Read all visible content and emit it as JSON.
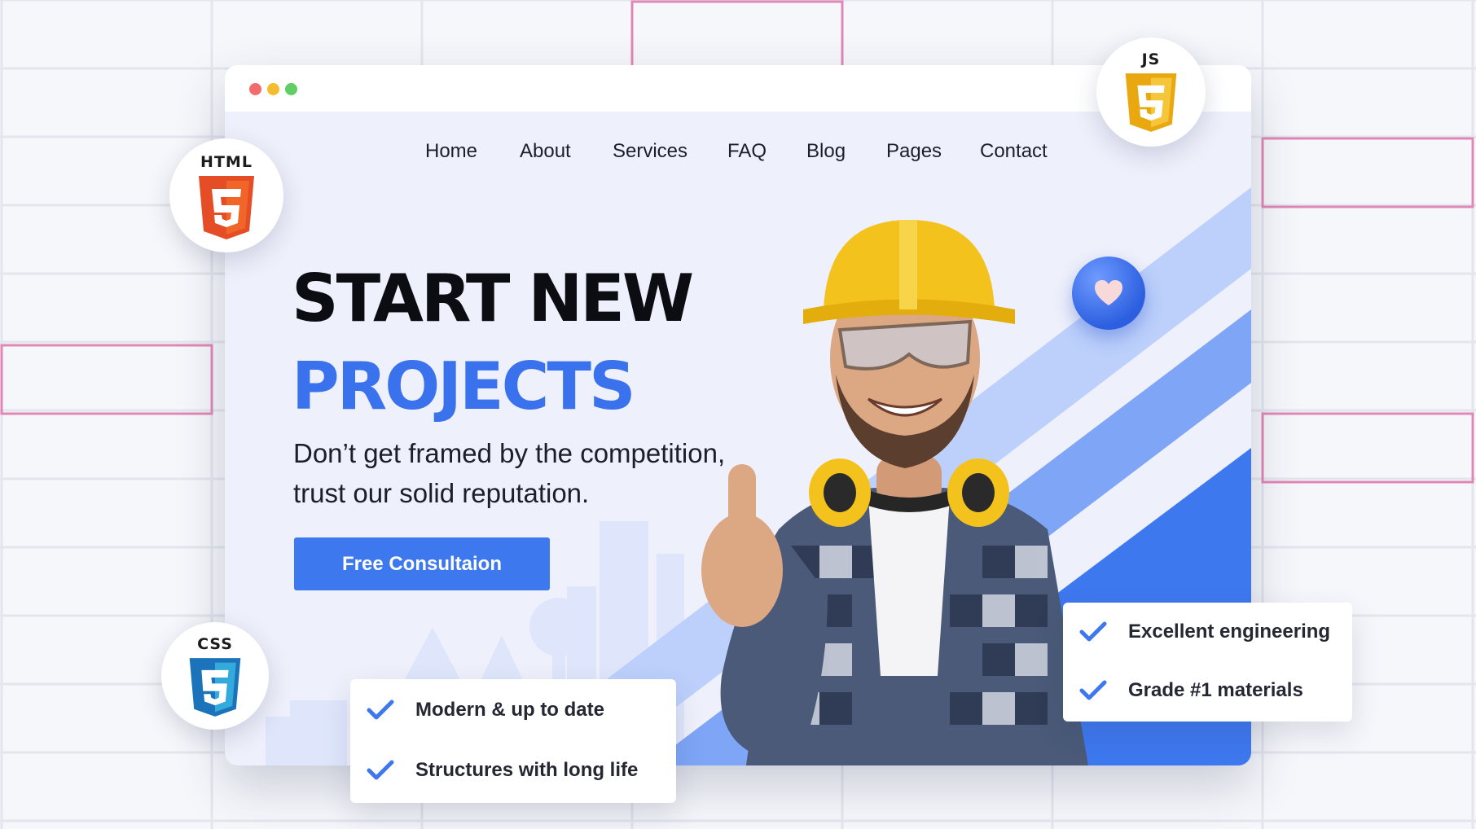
{
  "icons": {
    "window_controls": [
      "close-dot",
      "minimize-dot",
      "maximize-dot"
    ],
    "check": "check-icon",
    "heart": "heart-icon",
    "html_logo": "html5-shield-icon",
    "css_logo": "css3-shield-icon",
    "js_logo": "js-shield-icon"
  },
  "nav": {
    "items": [
      {
        "label": "Home"
      },
      {
        "label": "About"
      },
      {
        "label": "Services"
      },
      {
        "label": "FAQ"
      },
      {
        "label": "Blog"
      },
      {
        "label": "Pages"
      },
      {
        "label": "Contact"
      }
    ]
  },
  "hero": {
    "headline_line1": "START NEW",
    "headline_line2": "PROJECTS",
    "subtitle_line1": "Don’t get framed by the competition,",
    "subtitle_line2": "trust our solid reputation.",
    "cta_label": "Free Consultaion"
  },
  "badges": {
    "html": "HTML",
    "css": "CSS",
    "js": "JS"
  },
  "cards": {
    "left": [
      {
        "label": "Modern & up to date"
      },
      {
        "label": "Structures with long life"
      }
    ],
    "right": [
      {
        "label": "Excellent engineering"
      },
      {
        "label": "Grade #1 materials"
      }
    ]
  },
  "colors": {
    "accent_blue": "#3e78ee",
    "light_blue": "#b9cdfb",
    "headline_dark": "#0c0d12",
    "html_orange": "#e44d26",
    "css_blue": "#1b73ba",
    "js_yellow": "#f0b429",
    "helmet_yellow": "#f4c21c"
  }
}
